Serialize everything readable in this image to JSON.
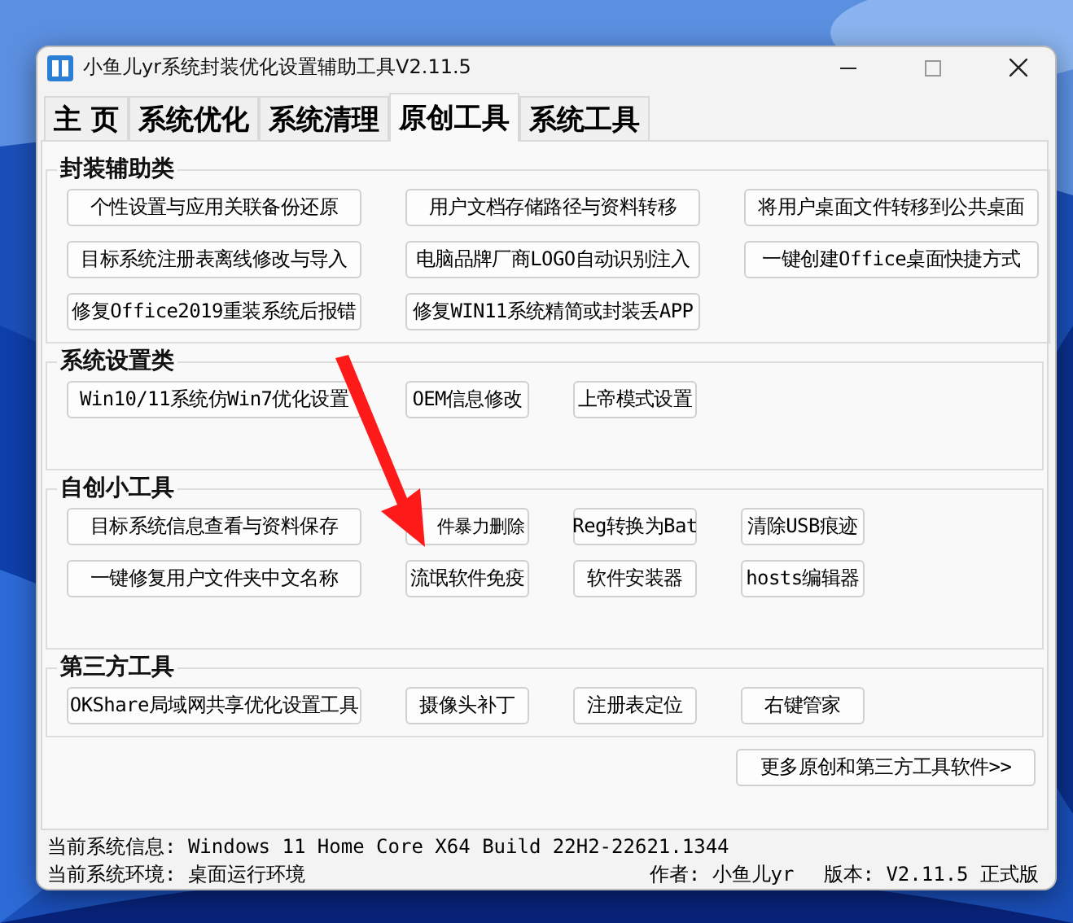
{
  "window": {
    "title": "小鱼儿yr系统封装优化设置辅助工具V2.11.5"
  },
  "tabs": [
    {
      "label": "主 页",
      "selected": false
    },
    {
      "label": "系统优化",
      "selected": false
    },
    {
      "label": "系统清理",
      "selected": false
    },
    {
      "label": "原创工具",
      "selected": true
    },
    {
      "label": "系统工具",
      "selected": false
    }
  ],
  "groups": [
    {
      "title": "封装辅助类",
      "rows": [
        [
          {
            "label": "个性设置与应用关联备份还原",
            "kind": "wide"
          },
          {
            "label": "用户文档存储路径与资料转移",
            "kind": "wide"
          },
          {
            "label": "将用户桌面文件转移到公共桌面",
            "kind": "wide"
          }
        ],
        [
          {
            "label": "目标系统注册表离线修改与导入",
            "kind": "wide"
          },
          {
            "label": "电脑品牌厂商LOGO自动识别注入",
            "kind": "wide"
          },
          {
            "label": "一键创建Office桌面快捷方式",
            "kind": "wide"
          }
        ],
        [
          {
            "label": "修复Office2019重装系统后报错",
            "kind": "wide"
          },
          {
            "label": "修复WIN11系统精简或封装丢APP",
            "kind": "wide"
          }
        ]
      ]
    },
    {
      "title": "系统设置类",
      "rows": [
        [
          {
            "label": "Win10/11系统仿Win7优化设置",
            "kind": "wide"
          },
          {
            "label": "OEM信息修改",
            "kind": "small"
          },
          {
            "label": "上帝模式设置",
            "kind": "small"
          }
        ]
      ]
    },
    {
      "title": "自创小工具",
      "rows": [
        [
          {
            "label": "目标系统信息查看与资料保存",
            "kind": "wide"
          },
          {
            "label": "件暴力删除",
            "kind": "small"
          },
          {
            "label": "Reg转换为Bat",
            "kind": "small"
          },
          {
            "label": "清除USB痕迹",
            "kind": "small"
          }
        ],
        [
          {
            "label": "一键修复用户文件夹中文名称",
            "kind": "wide"
          },
          {
            "label": "流氓软件免疫",
            "kind": "small"
          },
          {
            "label": "软件安装器",
            "kind": "small"
          },
          {
            "label": "hosts编辑器",
            "kind": "small"
          }
        ]
      ]
    },
    {
      "title": "第三方工具",
      "rows": [
        [
          {
            "label": "OKShare局域网共享优化设置工具",
            "kind": "wide"
          },
          {
            "label": "摄像头补丁",
            "kind": "small"
          },
          {
            "label": "注册表定位",
            "kind": "small"
          },
          {
            "label": "右键管家",
            "kind": "small"
          }
        ]
      ]
    }
  ],
  "more_button": "更多原创和第三方工具软件>>",
  "status_bar": {
    "system_info": "当前系统信息: Windows 11 Home Core X64 Build 22H2-22621.1344",
    "environment": "当前系统环境: 桌面运行环境",
    "author": "作者: 小鱼儿yr",
    "version": "版本: V2.11.5 正式版"
  }
}
